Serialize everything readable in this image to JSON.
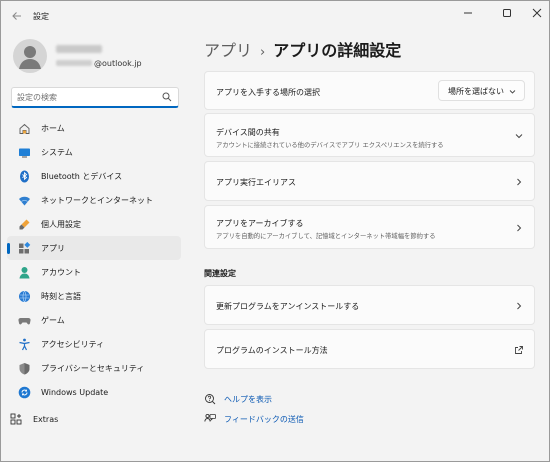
{
  "window": {
    "title": "設定"
  },
  "profile": {
    "email_domain": "@outlook.jp"
  },
  "search": {
    "placeholder": "設定の検索"
  },
  "nav": {
    "items": [
      {
        "label": "ホーム",
        "icon": "home-icon"
      },
      {
        "label": "システム",
        "icon": "system-icon"
      },
      {
        "label": "Bluetooth とデバイス",
        "icon": "bluetooth-icon"
      },
      {
        "label": "ネットワークとインターネット",
        "icon": "network-icon"
      },
      {
        "label": "個人用設定",
        "icon": "personalization-icon"
      },
      {
        "label": "アプリ",
        "icon": "apps-icon",
        "active": true
      },
      {
        "label": "アカウント",
        "icon": "account-icon"
      },
      {
        "label": "時刻と言語",
        "icon": "time-language-icon"
      },
      {
        "label": "ゲーム",
        "icon": "gaming-icon"
      },
      {
        "label": "アクセシビリティ",
        "icon": "accessibility-icon"
      },
      {
        "label": "プライバシーとセキュリティ",
        "icon": "privacy-icon"
      },
      {
        "label": "Windows Update",
        "icon": "windows-update-icon"
      }
    ],
    "extras": {
      "label": "Extras",
      "icon": "extras-icon"
    }
  },
  "breadcrumb": {
    "parent": "アプリ",
    "separator": "›",
    "current": "アプリの詳細設定"
  },
  "cards": {
    "install_source": {
      "title": "アプリを入手する場所の選択",
      "dropdown_value": "場所を選ばない"
    },
    "share_across_devices": {
      "title": "デバイス間の共有",
      "subtitle": "アカウントに接続されている他のデバイスでアプリ エクスペリエンスを続行する"
    },
    "execution_alias": {
      "title": "アプリ実行エイリアス"
    },
    "archive_apps": {
      "title": "アプリをアーカイブする",
      "subtitle": "アプリを自動的にアーカイブして、記憶域とインターネット帯域幅を節約する"
    }
  },
  "related": {
    "heading": "関連設定",
    "uninstall_updates": "更新プログラムをアンインストールする",
    "install_programs": "プログラムのインストール方法"
  },
  "help": {
    "get_help": "ヘルプを表示",
    "feedback": "フィードバックの送信"
  },
  "colors": {
    "accent": "#0067c0",
    "link": "#0a58b3"
  }
}
